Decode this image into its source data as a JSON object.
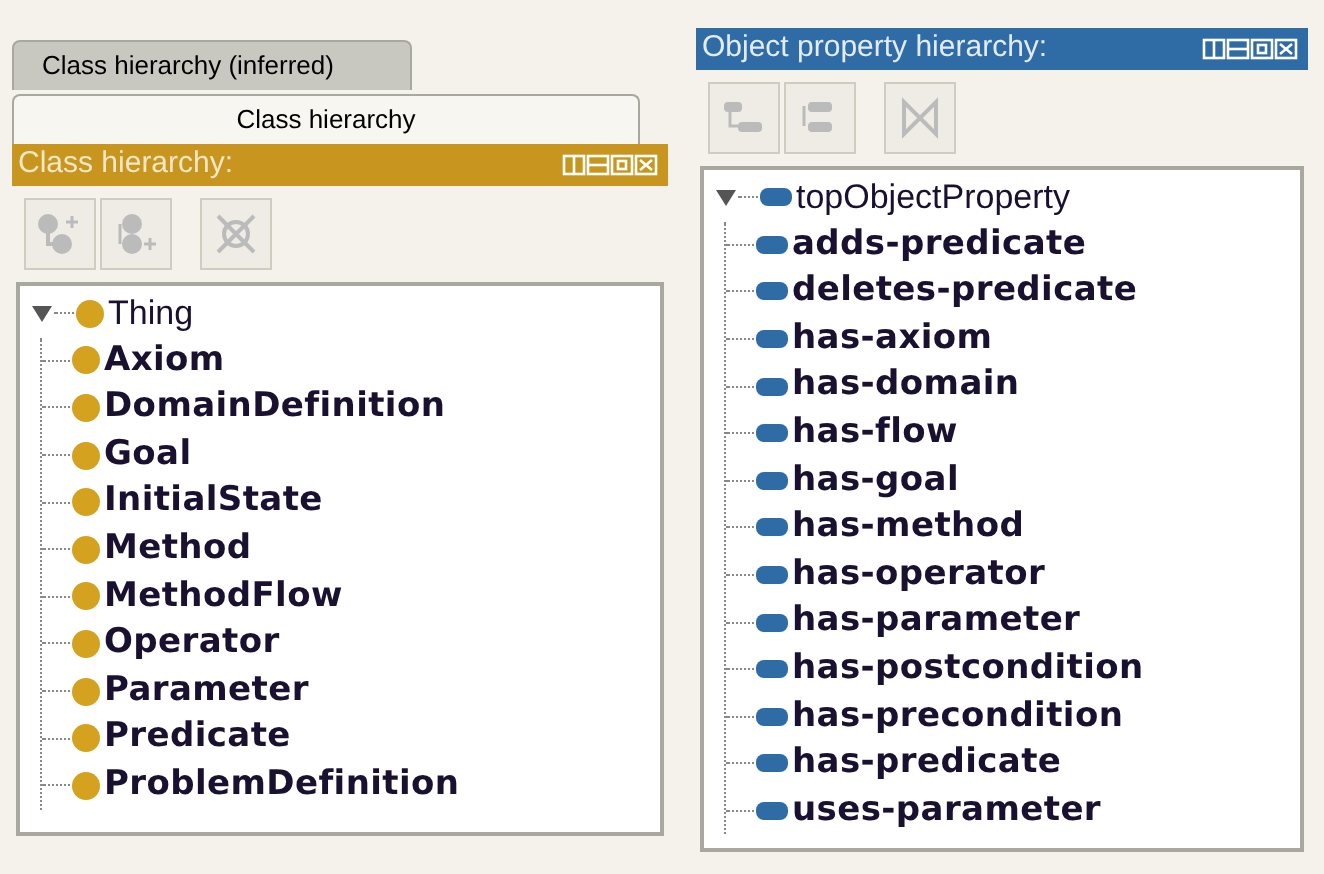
{
  "left_panel": {
    "tabs": [
      {
        "label": "Class hierarchy (inferred)",
        "selected": false
      },
      {
        "label": "Class hierarchy",
        "selected": true
      }
    ],
    "view": {
      "title": "Class hierarchy:",
      "kind": "class",
      "tree": [
        {
          "label": "Thing",
          "expanded": true,
          "children": [
            {
              "label": "Axiom"
            },
            {
              "label": "DomainDefinition"
            },
            {
              "label": "Goal"
            },
            {
              "label": "InitialState"
            },
            {
              "label": "Method"
            },
            {
              "label": "MethodFlow"
            },
            {
              "label": "Operator"
            },
            {
              "label": "Parameter"
            },
            {
              "label": "Predicate"
            },
            {
              "label": "ProblemDefinition"
            }
          ]
        }
      ]
    }
  },
  "right_panel": {
    "view": {
      "title": "Object property hierarchy:",
      "kind": "property",
      "tree": [
        {
          "label": "topObjectProperty",
          "expanded": true,
          "children": [
            {
              "label": "adds-predicate"
            },
            {
              "label": "deletes-predicate"
            },
            {
              "label": "has-axiom"
            },
            {
              "label": "has-domain"
            },
            {
              "label": "has-flow"
            },
            {
              "label": "has-goal"
            },
            {
              "label": "has-method"
            },
            {
              "label": "has-operator"
            },
            {
              "label": "has-parameter"
            },
            {
              "label": "has-postcondition"
            },
            {
              "label": "has-precondition"
            },
            {
              "label": "has-predicate"
            },
            {
              "label": "uses-parameter"
            }
          ]
        }
      ]
    }
  }
}
